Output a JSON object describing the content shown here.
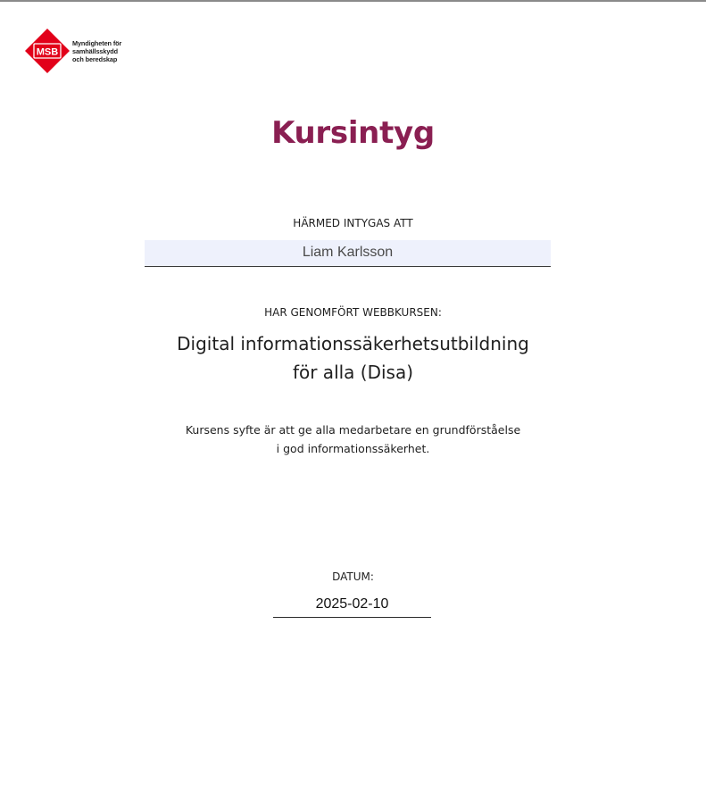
{
  "logo": {
    "abbreviation": "MSB",
    "name_lines": [
      "Myndigheten för",
      "samhällsskydd",
      "och beredskap"
    ],
    "color": "#e2001a"
  },
  "certificate": {
    "title": "Kursintyg",
    "title_color": "#8a1f52",
    "certify_label": "HÄRMED INTYGAS ATT",
    "participant_name": "Liam Karlsson",
    "course_label": "HAR GENOMFÖRT WEBBKURSEN:",
    "course_title_lines": [
      "Digital informationssäkerhetsutbildning",
      "för alla (Disa)"
    ],
    "purpose_lines": [
      "Kursens syfte är att ge alla medarbetare en grundförståelse",
      "i god informationssäkerhet."
    ],
    "date_label": "DATUM:",
    "date": "2025-02-10"
  }
}
